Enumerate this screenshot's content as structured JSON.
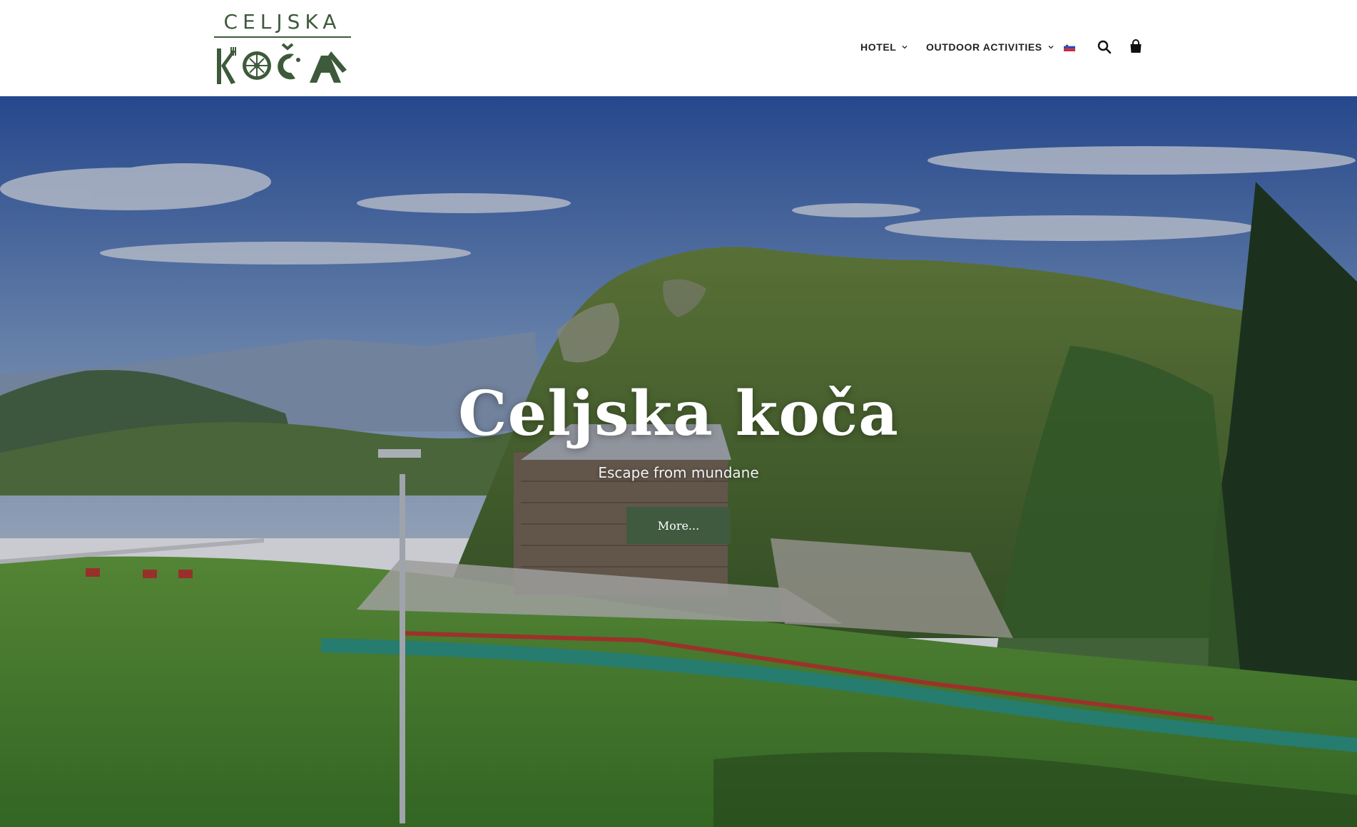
{
  "logo": {
    "top_text": "CELJSKA"
  },
  "nav": {
    "items": [
      {
        "label": "HOTEL",
        "icon": "chevron-down-icon"
      },
      {
        "label": "OUTDOOR ACTIVITIES",
        "icon": "chevron-down-icon"
      }
    ],
    "language_icon": "slovenian-flag-icon",
    "search_icon": "search-icon",
    "cart_icon": "shopping-bag-icon"
  },
  "hero": {
    "title": "Celjska koča",
    "subtitle": "Escape from mundane",
    "button_label": "More..."
  },
  "colors": {
    "brand_green": "#3d5a3a",
    "button_green": "#3f5a3f",
    "header_bg": "#ffffff",
    "nav_text": "#222222"
  }
}
